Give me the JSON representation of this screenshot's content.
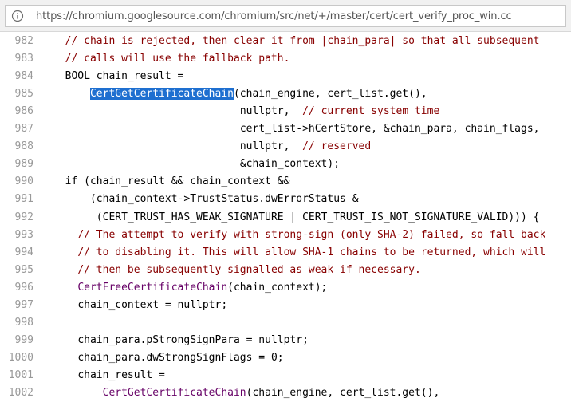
{
  "browser": {
    "url": "https://chromium.googlesource.com/chromium/src/net/+/master/cert/cert_verify_proc_win.cc",
    "info_icon": "info-icon"
  },
  "code": {
    "lines": [
      {
        "num": "982",
        "indent": "  ",
        "segments": [
          {
            "t": "// chain is rejected, then clear it from |chain_para| so that all subsequent",
            "c": "cm"
          }
        ]
      },
      {
        "num": "983",
        "indent": "  ",
        "segments": [
          {
            "t": "// calls will use the fallback path.",
            "c": "cm"
          }
        ]
      },
      {
        "num": "984",
        "indent": "  ",
        "segments": [
          {
            "t": "BOOL chain_result =",
            "c": "tx"
          }
        ]
      },
      {
        "num": "985",
        "indent": "      ",
        "segments": [
          {
            "t": "CertGetCertificateChain",
            "c": "sel"
          },
          {
            "t": "(chain_engine, cert_list.get(),",
            "c": "tx"
          }
        ]
      },
      {
        "num": "986",
        "indent": "                              ",
        "segments": [
          {
            "t": "nullptr,  ",
            "c": "tx"
          },
          {
            "t": "// current system time",
            "c": "cm"
          }
        ]
      },
      {
        "num": "987",
        "indent": "                              ",
        "segments": [
          {
            "t": "cert_list->hCertStore, &chain_para, chain_flags,",
            "c": "tx"
          }
        ]
      },
      {
        "num": "988",
        "indent": "                              ",
        "segments": [
          {
            "t": "nullptr,  ",
            "c": "tx"
          },
          {
            "t": "// reserved",
            "c": "cm"
          }
        ]
      },
      {
        "num": "989",
        "indent": "                              ",
        "segments": [
          {
            "t": "&chain_context);",
            "c": "tx"
          }
        ]
      },
      {
        "num": "990",
        "indent": "  ",
        "segments": [
          {
            "t": "if (chain_result && chain_context &&",
            "c": "tx"
          }
        ]
      },
      {
        "num": "991",
        "indent": "      ",
        "segments": [
          {
            "t": "(chain_context->TrustStatus.dwErrorStatus &",
            "c": "tx"
          }
        ]
      },
      {
        "num": "992",
        "indent": "       ",
        "segments": [
          {
            "t": "(CERT_TRUST_HAS_WEAK_SIGNATURE | CERT_TRUST_IS_NOT_SIGNATURE_VALID))) {",
            "c": "tx"
          }
        ]
      },
      {
        "num": "993",
        "indent": "    ",
        "segments": [
          {
            "t": "// The attempt to verify with strong-sign (only SHA-2) failed, so fall back",
            "c": "cm"
          }
        ]
      },
      {
        "num": "994",
        "indent": "    ",
        "segments": [
          {
            "t": "// to disabling it. This will allow SHA-1 chains to be returned, which will",
            "c": "cm"
          }
        ]
      },
      {
        "num": "995",
        "indent": "    ",
        "segments": [
          {
            "t": "// then be subsequently signalled as weak if necessary.",
            "c": "cm"
          }
        ]
      },
      {
        "num": "996",
        "indent": "    ",
        "segments": [
          {
            "t": "CertFreeCertificateChain",
            "c": "fn"
          },
          {
            "t": "(chain_context);",
            "c": "tx"
          }
        ]
      },
      {
        "num": "997",
        "indent": "    ",
        "segments": [
          {
            "t": "chain_context = nullptr;",
            "c": "tx"
          }
        ]
      },
      {
        "num": "998",
        "indent": "",
        "segments": []
      },
      {
        "num": "999",
        "indent": "    ",
        "segments": [
          {
            "t": "chain_para.pStrongSignPara = nullptr;",
            "c": "tx"
          }
        ]
      },
      {
        "num": "1000",
        "indent": "    ",
        "segments": [
          {
            "t": "chain_para.dwStrongSignFlags = 0;",
            "c": "tx"
          }
        ]
      },
      {
        "num": "1001",
        "indent": "    ",
        "segments": [
          {
            "t": "chain_result =",
            "c": "tx"
          }
        ]
      },
      {
        "num": "1002",
        "indent": "        ",
        "segments": [
          {
            "t": "CertGetCertificateChain",
            "c": "fn"
          },
          {
            "t": "(chain_engine, cert_list.get(),",
            "c": "tx"
          }
        ]
      }
    ]
  }
}
